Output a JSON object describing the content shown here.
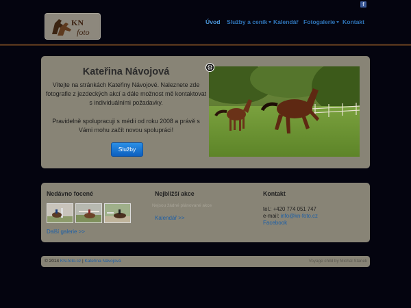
{
  "header": {
    "social_icon": "facebook-icon",
    "logo": {
      "text": "KN foto"
    },
    "nav": [
      {
        "label": "Úvod",
        "dropdown": false,
        "active": true
      },
      {
        "label": "Služby a ceník",
        "dropdown": true,
        "active": false
      },
      {
        "label": "Kalendář",
        "dropdown": false,
        "active": false
      },
      {
        "label": "Fotogalerie",
        "dropdown": true,
        "active": false
      },
      {
        "label": "Kontakt",
        "dropdown": false,
        "active": false
      }
    ]
  },
  "hero": {
    "title": "Kateřina Návojová",
    "intro": "Vítejte na stránkách Kateřiny Návojové. Naleznete zde fotografie z jezdeckých akcí a dále možnost mě kontaktovat s individuálními požadavky.",
    "second": "Pravidelně spolupracuji s médii od roku 2008 a právě s Vámi mohu začít novou spolupráci!",
    "button": "Služby",
    "settings_icon": "gear-icon"
  },
  "recent": {
    "title": "Nedávno focené",
    "more": "Další galerie >>"
  },
  "events": {
    "title": "Nejbližší akce",
    "empty": "Nejsou žádné plánované akce",
    "calendar_link": "Kalendář >>"
  },
  "contact": {
    "title": "Kontakt",
    "phone": "tel.: +420 774 051 747",
    "email_label": "e-mail: ",
    "email": "info@kn-foto.cz",
    "facebook": "Facebook"
  },
  "footer": {
    "copy": "© 2014 ",
    "site": "KN-foto.cz",
    "sep": " | ",
    "name": "Kateřina Návojová",
    "credit": "Voyage child by Michal Stanek"
  },
  "colors": {
    "background": "#04040f",
    "panel": "#888476",
    "link": "#2f74b8",
    "button": "#0d5fbf"
  }
}
